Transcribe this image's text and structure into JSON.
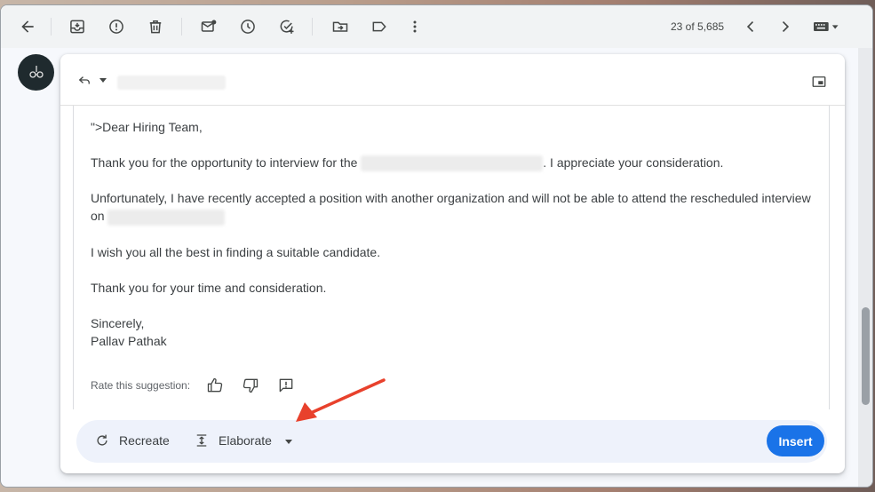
{
  "toolbar": {
    "counter": "23 of 5,685",
    "icons": [
      "back-arrow-icon",
      "archive-icon",
      "report-spam-icon",
      "delete-icon",
      "mark-unread-icon",
      "snooze-icon",
      "add-task-icon",
      "move-to-icon",
      "label-icon",
      "more-options-icon",
      "newer-icon",
      "older-icon",
      "input-tools-icon"
    ]
  },
  "email": {
    "greeting": "\">Dear Hiring Team,",
    "para1_start": "Thank you for the opportunity to interview for the ",
    "para1_end": ". I appreciate your consideration.",
    "para2_start": "Unfortunately, I have recently accepted a position with another organization and will not be able to attend the rescheduled interview on ",
    "para3": "I wish you all the best in finding a suitable candidate.",
    "para4": "Thank you for your time and consideration.",
    "closing": "Sincerely,",
    "signature": "Pallav Pathak"
  },
  "rating": {
    "label": "Rate this suggestion:"
  },
  "actions": {
    "recreate_label": "Recreate",
    "elaborate_label": "Elaborate",
    "insert_label": "Insert"
  },
  "colors": {
    "accent": "#1a73e8",
    "annotation_arrow": "#e8412c"
  }
}
